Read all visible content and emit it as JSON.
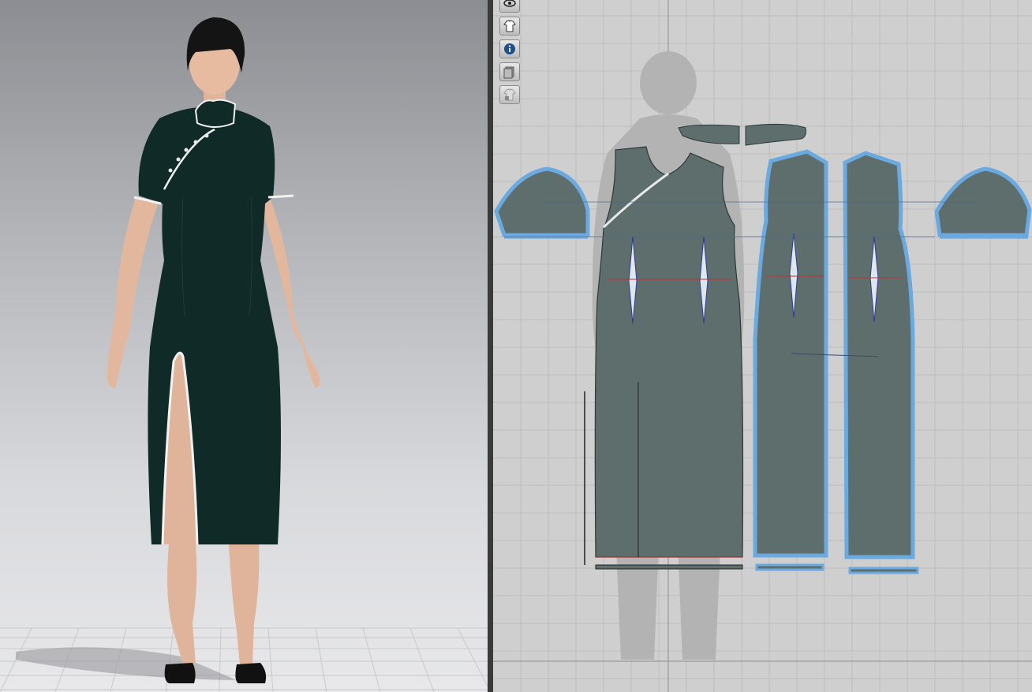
{
  "app": {
    "view_3d_label": "",
    "view_2d_label": ""
  },
  "toolbar_2d": {
    "tools": [
      {
        "icon": "show-avatar-eye-icon"
      },
      {
        "icon": "show-garment-icon"
      },
      {
        "icon": "info-icon"
      },
      {
        "icon": "layer-icon"
      },
      {
        "icon": "lock-garment-icon"
      }
    ]
  },
  "colors": {
    "garment": "#0f2a27",
    "pattern_fill": "#5e6e6c",
    "selection_outline": "#6aaae0",
    "piping": "#f2f2f2",
    "grid_bg": "#cfcfcf"
  }
}
